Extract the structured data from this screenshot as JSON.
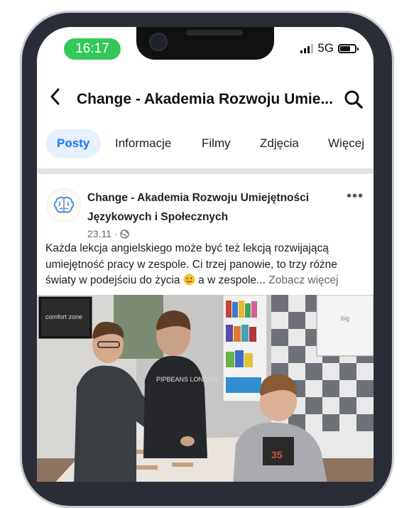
{
  "status_bar": {
    "time": "16:17",
    "network": "5G"
  },
  "header": {
    "title": "Change - Akademia Rozwoju Umie..."
  },
  "tabs": [
    {
      "label": "Posty"
    },
    {
      "label": "Informacje"
    },
    {
      "label": "Filmy"
    },
    {
      "label": "Zdjęcia"
    },
    {
      "label": "Więcej"
    }
  ],
  "post": {
    "author": "Change - Akademia Rozwoju Umiejętności Językowych i Społecznych",
    "date": "23.11",
    "text": "Każda lekcja angielskiego może być też lekcją rozwijającą umiejętność pracy w zespole. Ci trzej panowie, to trzy różne światy w podejściu do życia",
    "text_end": "a w zespole...",
    "see_more": "Zobacz więcej",
    "emoji": "smiling-face"
  },
  "photo": {
    "poster_text": "comfort zone",
    "hoodie_text": "PIPBEANS LONDON",
    "shirt_number": "35",
    "board_text": "big"
  },
  "colors": {
    "accent": "#1877f2",
    "status_pill": "#34c759"
  },
  "icons": [
    "back-arrow-icon",
    "search-icon",
    "globe-icon",
    "more-options-icon",
    "brain-logo-icon",
    "dropdown-caret-icon"
  ]
}
